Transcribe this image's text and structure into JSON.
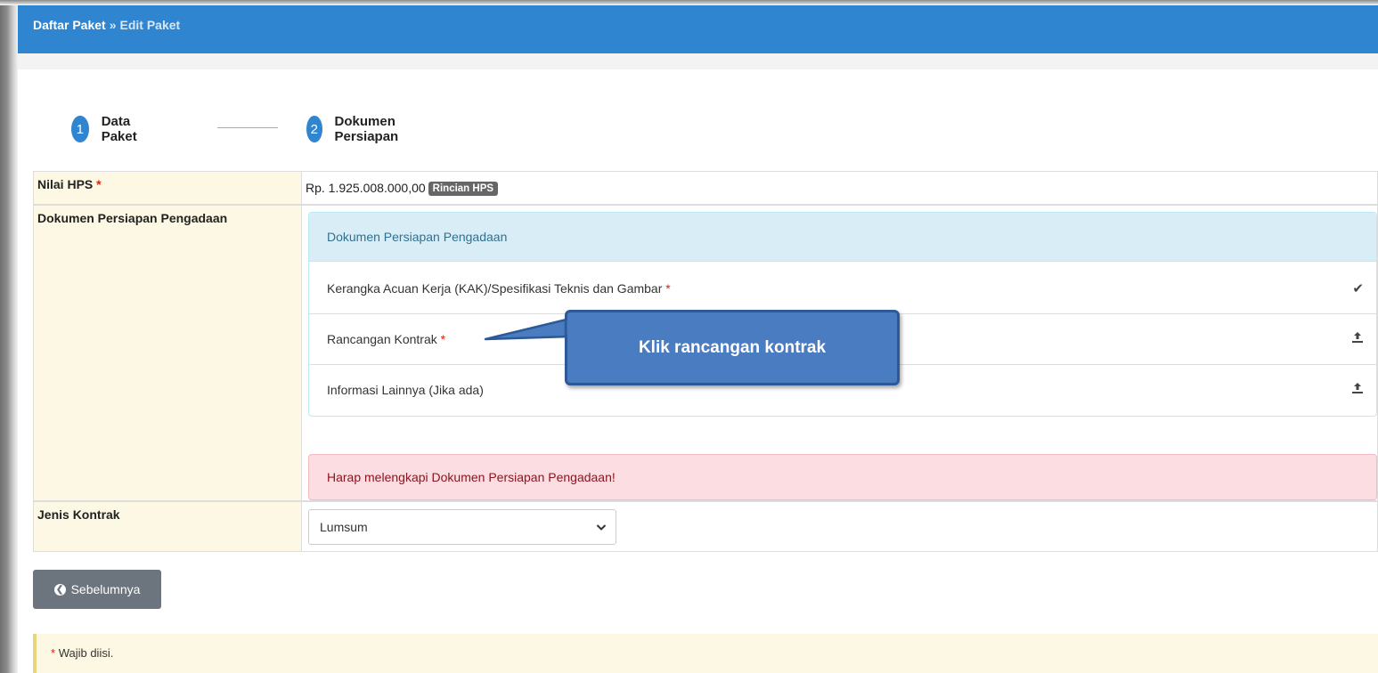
{
  "breadcrumb": {
    "parent": "Daftar Paket",
    "separator": "»",
    "current": "Edit Paket"
  },
  "steps": [
    {
      "number": "1",
      "label": "Data Paket"
    },
    {
      "number": "2",
      "label": "Dokumen Persiapan"
    }
  ],
  "nilai_hps": {
    "label": "Nilai HPS",
    "value": "Rp. 1.925.008.000,00",
    "button": "Rincian HPS"
  },
  "dokumen": {
    "label": "Dokumen Persiapan Pengadaan",
    "panel_title": "Dokumen Persiapan Pengadaan",
    "items": [
      {
        "label": "Kerangka Acuan Kerja (KAK)/Spesifikasi Teknis dan Gambar",
        "required": "*",
        "icon": "check-icon"
      },
      {
        "label": "Rancangan Kontrak",
        "required": "*",
        "icon": "upload-icon"
      },
      {
        "label": "Informasi Lainnya (Jika ada)",
        "required": "",
        "icon": "upload-icon"
      }
    ],
    "alert": "Harap melengkapi Dokumen Persiapan Pengadaan!"
  },
  "jenis_kontrak": {
    "label": "Jenis Kontrak",
    "selected": "Lumsum"
  },
  "prev_button": "Sebelumnya",
  "note": {
    "star": "*",
    "text": "Wajib diisi."
  },
  "callout": "Klik rancangan kontrak",
  "colors": {
    "primary": "#2f85d0",
    "callout": "#4a7cc2",
    "alert_bg": "#fcdde1",
    "label_bg": "#fcf8e3"
  }
}
